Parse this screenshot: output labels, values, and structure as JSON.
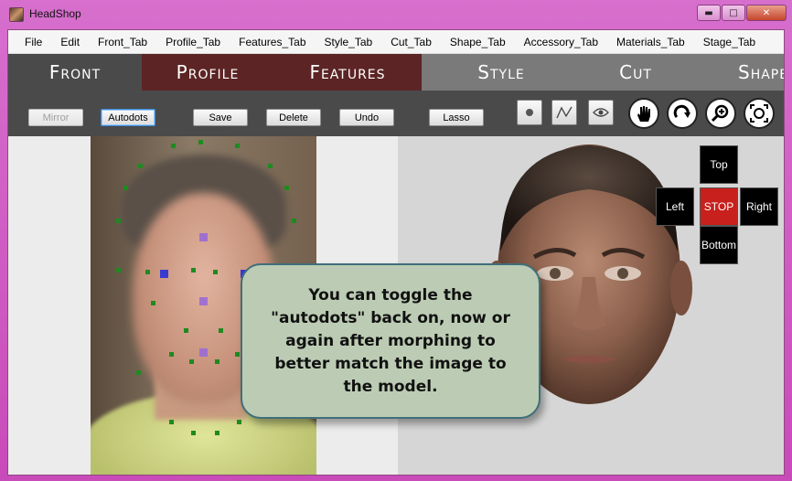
{
  "window": {
    "title": "HeadShop",
    "minimize": "▬",
    "maximize": "□",
    "close": "✕"
  },
  "menu": [
    "File",
    "Edit",
    "Front_Tab",
    "Profile_Tab",
    "Features_Tab",
    "Style_Tab",
    "Cut_Tab",
    "Shape_Tab",
    "Accessory_Tab",
    "Materials_Tab",
    "Stage_Tab"
  ],
  "tabs": [
    {
      "label": "Front",
      "bg": "#4a4a4a"
    },
    {
      "label": "Profile",
      "bg": "#5c2424"
    },
    {
      "label": "Features",
      "bg": "#5c2424"
    },
    {
      "label": "Style",
      "bg": "#7a7a7a"
    },
    {
      "label": "Cut",
      "bg": "#7a7a7a"
    },
    {
      "label": "Shape",
      "bg": "#7a7a7a"
    }
  ],
  "toolbar": {
    "mirror": "Mirror",
    "autodots": "Autodots",
    "save": "Save",
    "delete": "Delete",
    "undo": "Undo",
    "lasso": "Lasso",
    "icons": [
      "dot-tool-icon",
      "line-tool-icon",
      "eye-tool-icon",
      "hand-icon",
      "rotate-icon",
      "zoom-in-icon",
      "fit-view-icon"
    ]
  },
  "nav": {
    "top": "Top",
    "left": "Left",
    "stop": "STOP",
    "right": "Right",
    "bottom": "Bottom"
  },
  "callout": {
    "text": "You can toggle the \"autodots\" back on, now or again after morphing to better match the image to the model."
  },
  "colors": {
    "accent_tab": "#5c2424",
    "stop": "#c8201c",
    "callout_bg": "#bcccb4",
    "dot": "#1f8a1f"
  }
}
